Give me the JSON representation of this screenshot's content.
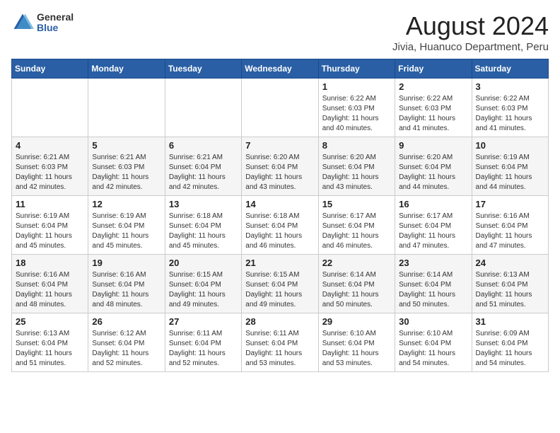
{
  "header": {
    "logo_general": "General",
    "logo_blue": "Blue",
    "month_title": "August 2024",
    "location": "Jivia, Huanuco Department, Peru"
  },
  "days_of_week": [
    "Sunday",
    "Monday",
    "Tuesday",
    "Wednesday",
    "Thursday",
    "Friday",
    "Saturday"
  ],
  "weeks": [
    [
      {
        "day": "",
        "info": ""
      },
      {
        "day": "",
        "info": ""
      },
      {
        "day": "",
        "info": ""
      },
      {
        "day": "",
        "info": ""
      },
      {
        "day": "1",
        "info": "Sunrise: 6:22 AM\nSunset: 6:03 PM\nDaylight: 11 hours\nand 40 minutes."
      },
      {
        "day": "2",
        "info": "Sunrise: 6:22 AM\nSunset: 6:03 PM\nDaylight: 11 hours\nand 41 minutes."
      },
      {
        "day": "3",
        "info": "Sunrise: 6:22 AM\nSunset: 6:03 PM\nDaylight: 11 hours\nand 41 minutes."
      }
    ],
    [
      {
        "day": "4",
        "info": "Sunrise: 6:21 AM\nSunset: 6:03 PM\nDaylight: 11 hours\nand 42 minutes."
      },
      {
        "day": "5",
        "info": "Sunrise: 6:21 AM\nSunset: 6:03 PM\nDaylight: 11 hours\nand 42 minutes."
      },
      {
        "day": "6",
        "info": "Sunrise: 6:21 AM\nSunset: 6:04 PM\nDaylight: 11 hours\nand 42 minutes."
      },
      {
        "day": "7",
        "info": "Sunrise: 6:20 AM\nSunset: 6:04 PM\nDaylight: 11 hours\nand 43 minutes."
      },
      {
        "day": "8",
        "info": "Sunrise: 6:20 AM\nSunset: 6:04 PM\nDaylight: 11 hours\nand 43 minutes."
      },
      {
        "day": "9",
        "info": "Sunrise: 6:20 AM\nSunset: 6:04 PM\nDaylight: 11 hours\nand 44 minutes."
      },
      {
        "day": "10",
        "info": "Sunrise: 6:19 AM\nSunset: 6:04 PM\nDaylight: 11 hours\nand 44 minutes."
      }
    ],
    [
      {
        "day": "11",
        "info": "Sunrise: 6:19 AM\nSunset: 6:04 PM\nDaylight: 11 hours\nand 45 minutes."
      },
      {
        "day": "12",
        "info": "Sunrise: 6:19 AM\nSunset: 6:04 PM\nDaylight: 11 hours\nand 45 minutes."
      },
      {
        "day": "13",
        "info": "Sunrise: 6:18 AM\nSunset: 6:04 PM\nDaylight: 11 hours\nand 45 minutes."
      },
      {
        "day": "14",
        "info": "Sunrise: 6:18 AM\nSunset: 6:04 PM\nDaylight: 11 hours\nand 46 minutes."
      },
      {
        "day": "15",
        "info": "Sunrise: 6:17 AM\nSunset: 6:04 PM\nDaylight: 11 hours\nand 46 minutes."
      },
      {
        "day": "16",
        "info": "Sunrise: 6:17 AM\nSunset: 6:04 PM\nDaylight: 11 hours\nand 47 minutes."
      },
      {
        "day": "17",
        "info": "Sunrise: 6:16 AM\nSunset: 6:04 PM\nDaylight: 11 hours\nand 47 minutes."
      }
    ],
    [
      {
        "day": "18",
        "info": "Sunrise: 6:16 AM\nSunset: 6:04 PM\nDaylight: 11 hours\nand 48 minutes."
      },
      {
        "day": "19",
        "info": "Sunrise: 6:16 AM\nSunset: 6:04 PM\nDaylight: 11 hours\nand 48 minutes."
      },
      {
        "day": "20",
        "info": "Sunrise: 6:15 AM\nSunset: 6:04 PM\nDaylight: 11 hours\nand 49 minutes."
      },
      {
        "day": "21",
        "info": "Sunrise: 6:15 AM\nSunset: 6:04 PM\nDaylight: 11 hours\nand 49 minutes."
      },
      {
        "day": "22",
        "info": "Sunrise: 6:14 AM\nSunset: 6:04 PM\nDaylight: 11 hours\nand 50 minutes."
      },
      {
        "day": "23",
        "info": "Sunrise: 6:14 AM\nSunset: 6:04 PM\nDaylight: 11 hours\nand 50 minutes."
      },
      {
        "day": "24",
        "info": "Sunrise: 6:13 AM\nSunset: 6:04 PM\nDaylight: 11 hours\nand 51 minutes."
      }
    ],
    [
      {
        "day": "25",
        "info": "Sunrise: 6:13 AM\nSunset: 6:04 PM\nDaylight: 11 hours\nand 51 minutes."
      },
      {
        "day": "26",
        "info": "Sunrise: 6:12 AM\nSunset: 6:04 PM\nDaylight: 11 hours\nand 52 minutes."
      },
      {
        "day": "27",
        "info": "Sunrise: 6:11 AM\nSunset: 6:04 PM\nDaylight: 11 hours\nand 52 minutes."
      },
      {
        "day": "28",
        "info": "Sunrise: 6:11 AM\nSunset: 6:04 PM\nDaylight: 11 hours\nand 53 minutes."
      },
      {
        "day": "29",
        "info": "Sunrise: 6:10 AM\nSunset: 6:04 PM\nDaylight: 11 hours\nand 53 minutes."
      },
      {
        "day": "30",
        "info": "Sunrise: 6:10 AM\nSunset: 6:04 PM\nDaylight: 11 hours\nand 54 minutes."
      },
      {
        "day": "31",
        "info": "Sunrise: 6:09 AM\nSunset: 6:04 PM\nDaylight: 11 hours\nand 54 minutes."
      }
    ]
  ]
}
